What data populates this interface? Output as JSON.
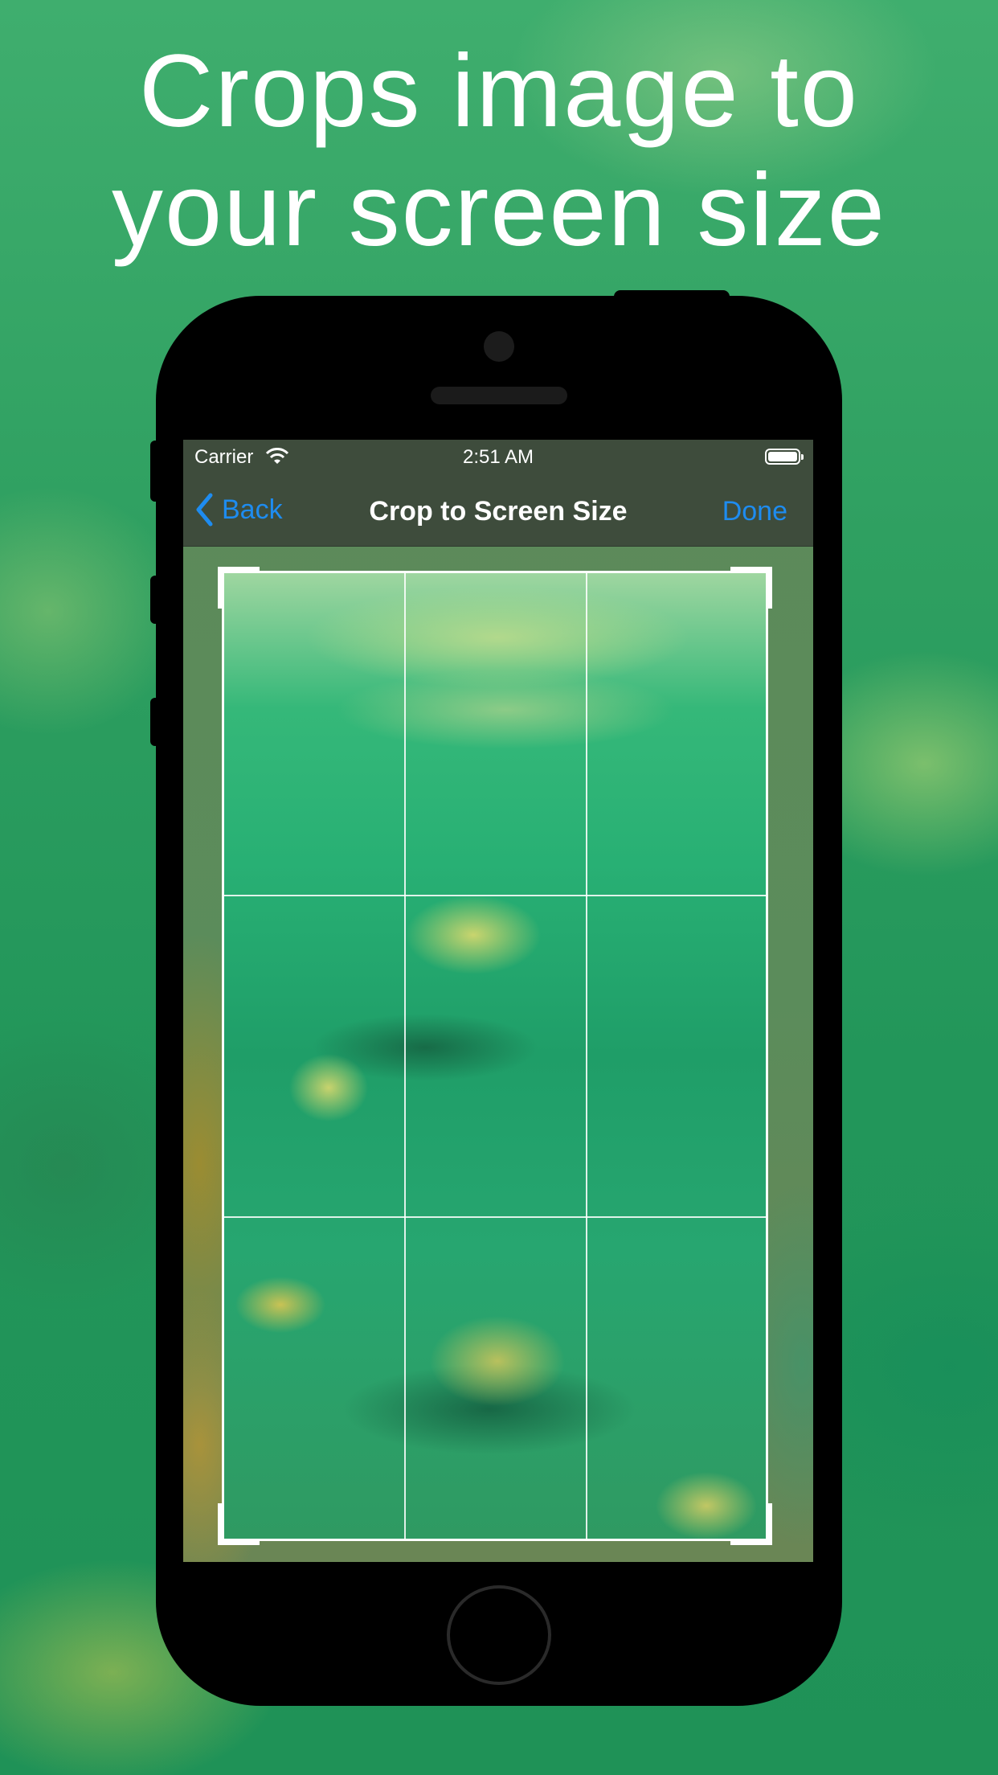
{
  "headline": {
    "line1": "Crops image to",
    "line2": "your screen size"
  },
  "status_bar": {
    "carrier": "Carrier",
    "time": "2:51 AM"
  },
  "nav_bar": {
    "back_label": "Back",
    "title": "Crop to Screen Size",
    "done_label": "Done"
  },
  "colors": {
    "accent": "#1e8cf0",
    "background": "#2fa061"
  }
}
